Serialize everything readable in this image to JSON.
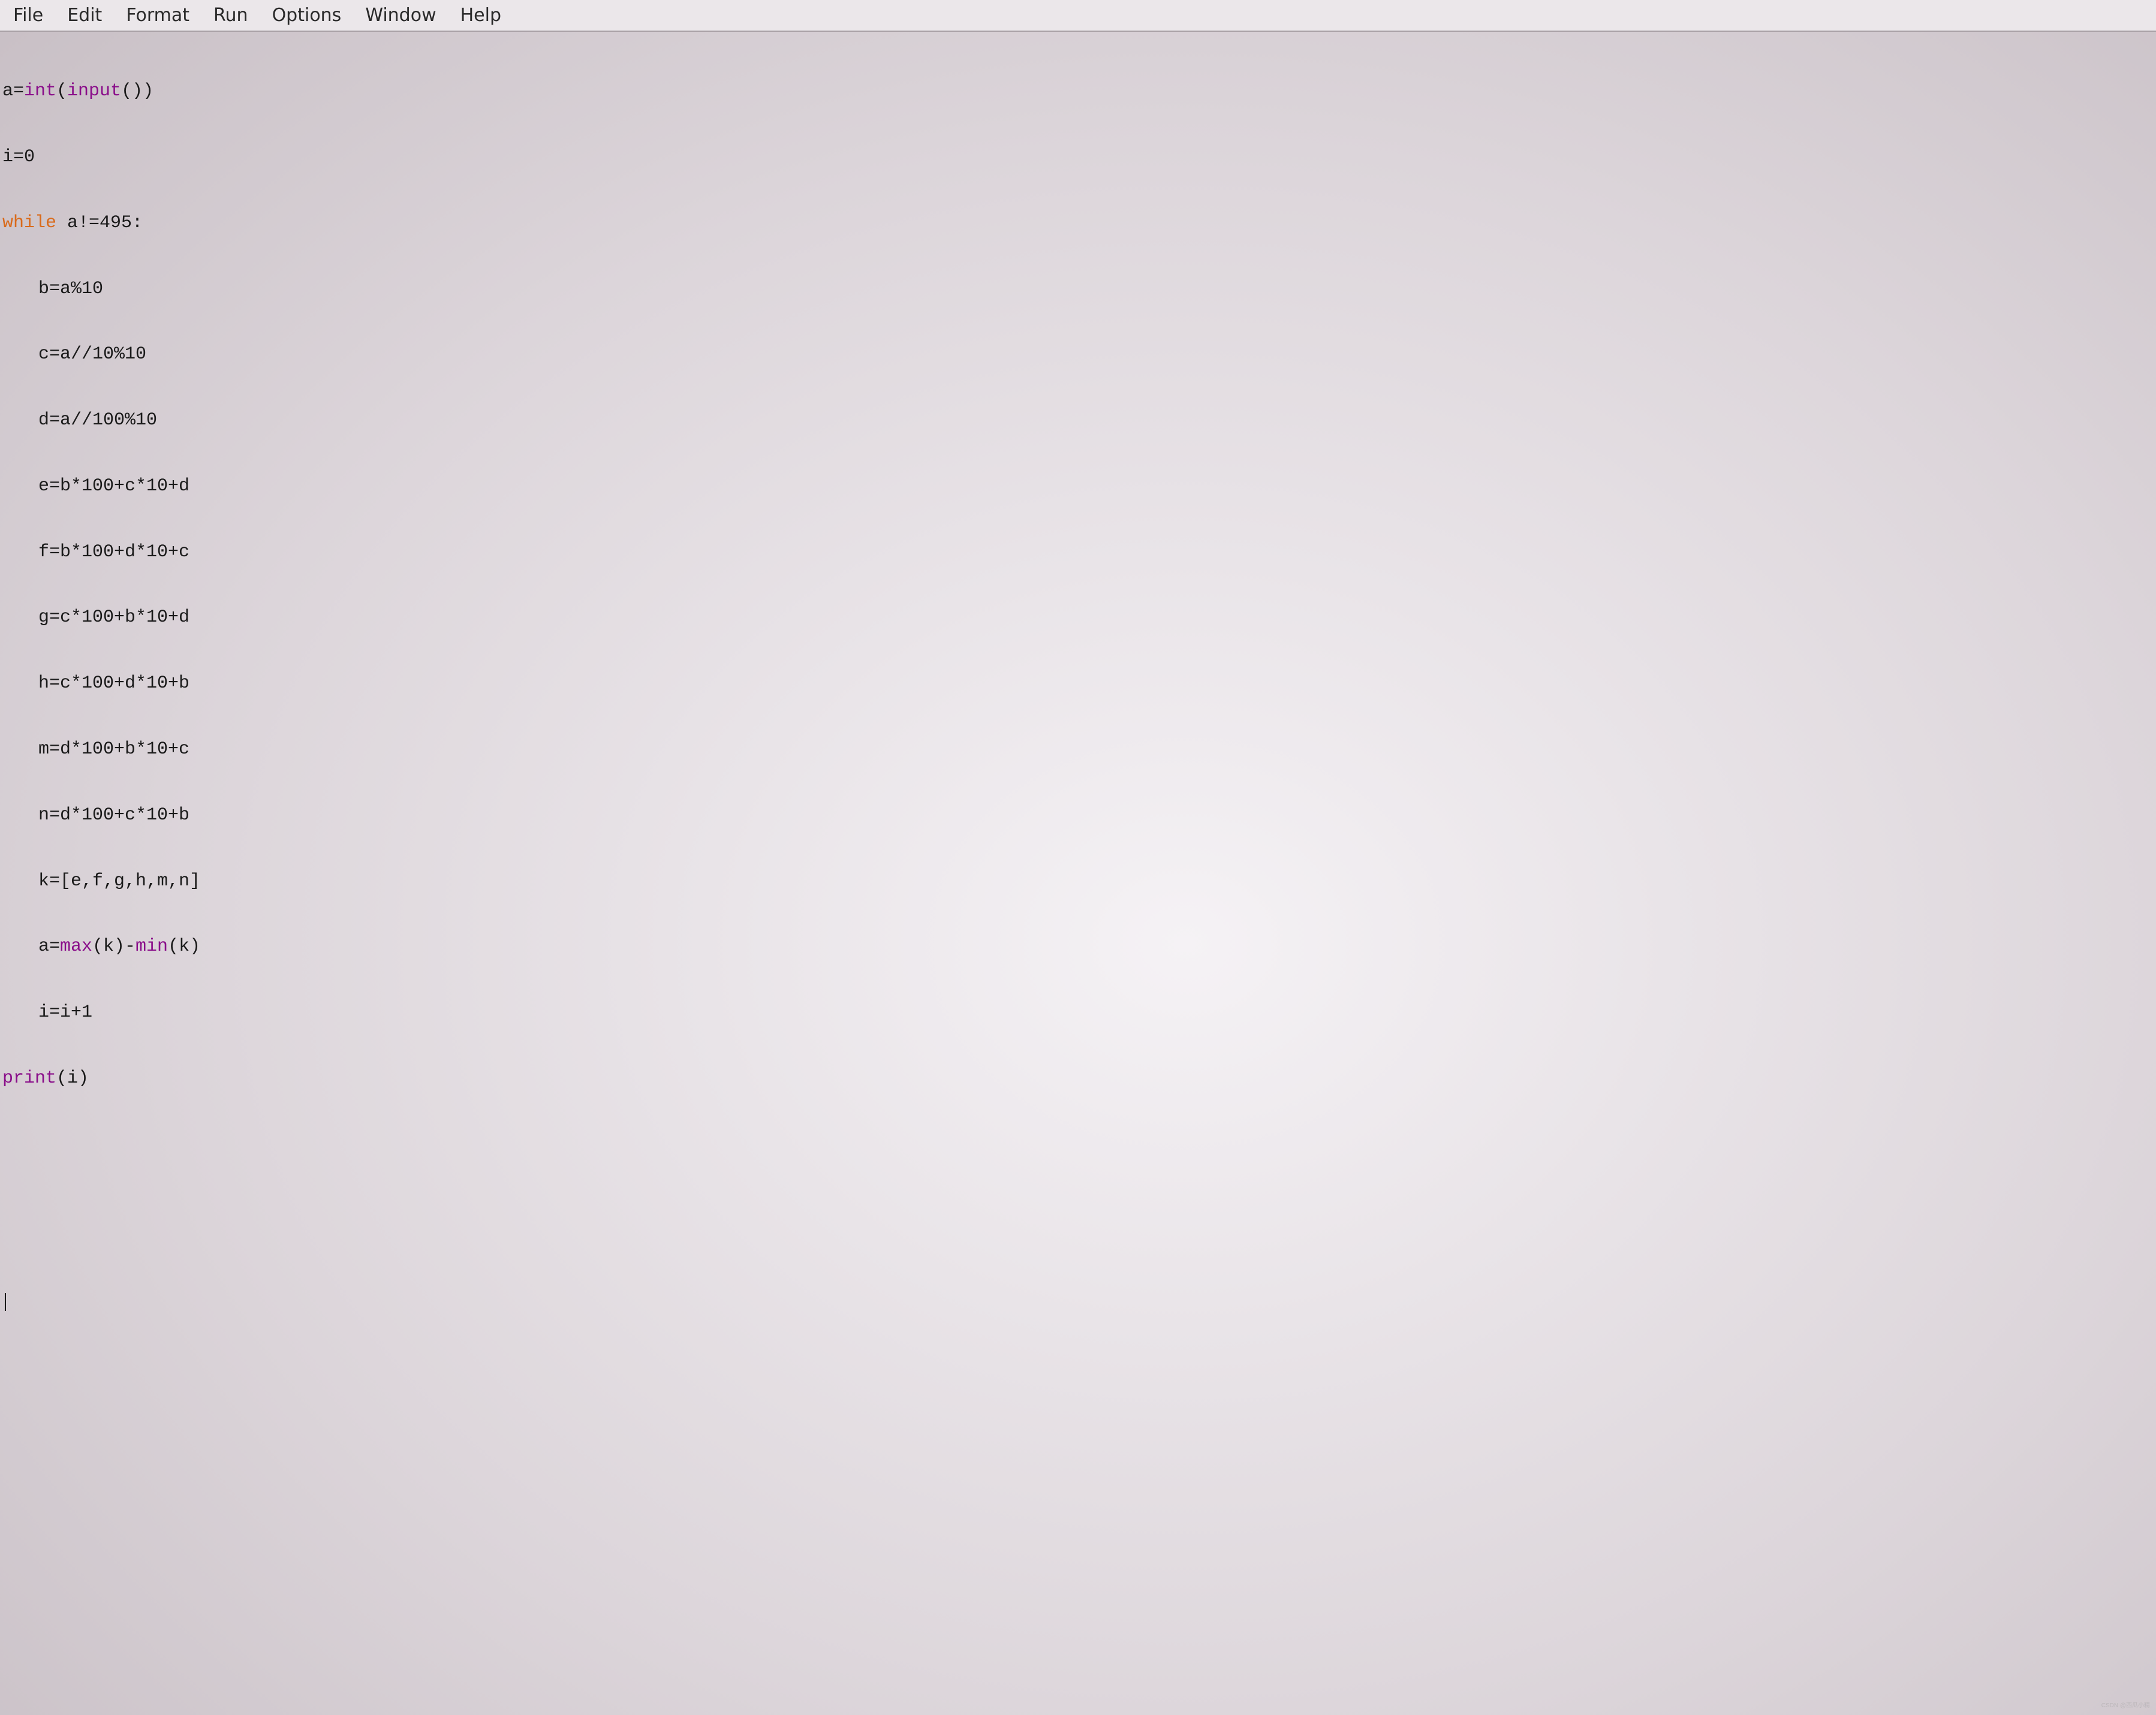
{
  "menu": {
    "file": "File",
    "edit": "Edit",
    "format": "Format",
    "run": "Run",
    "options": "Options",
    "window": "Window",
    "help": "Help"
  },
  "code": {
    "l1_a": "a=",
    "l1_int": "int",
    "l1_paren1": "(",
    "l1_input": "input",
    "l1_paren2": "())",
    "l2": "i=0",
    "l3_while": "while",
    "l3_cond": " a!=495:",
    "l4": "b=a%10",
    "l5": "c=a//10%10",
    "l6": "d=a//100%10",
    "l7": "e=b*100+c*10+d",
    "l8": "f=b*100+d*10+c",
    "l9": "g=c*100+b*10+d",
    "l10": "h=c*100+d*10+b",
    "l11": "m=d*100+b*10+c",
    "l12": "n=d*100+c*10+b",
    "l13": "k=[e,f,g,h,m,n]",
    "l14_a": "a=",
    "l14_max": "max",
    "l14_mid": "(k)-",
    "l14_min": "min",
    "l14_end": "(k)",
    "l15": "i=i+1",
    "l16_print": "print",
    "l16_arg": "(i)"
  },
  "watermark": "CSDN @西瓜小精"
}
